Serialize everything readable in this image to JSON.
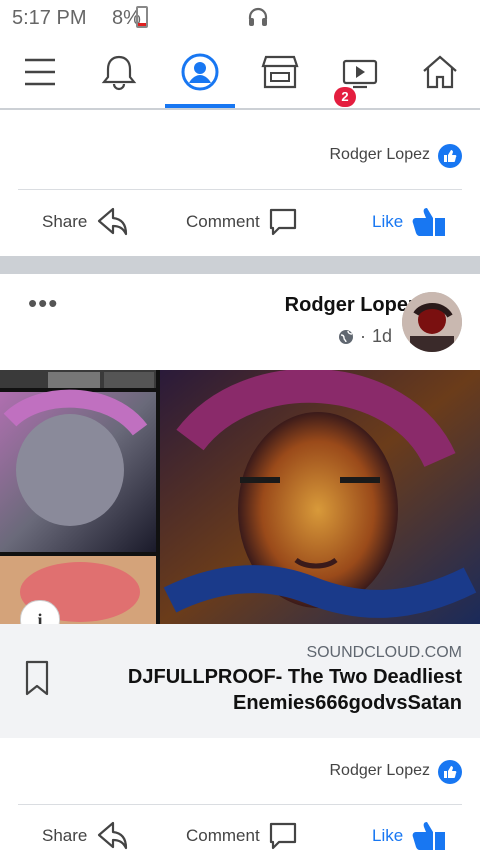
{
  "status": {
    "time": "5:17 PM",
    "battery": "8%"
  },
  "nav": {
    "badge": "2"
  },
  "post1": {
    "reactor": "Rodger Lopez",
    "like": "Like",
    "comment": "Comment",
    "share": "Share"
  },
  "post2": {
    "author": "Rodger Lopez",
    "time": "1d",
    "dot": "·",
    "more": "•••",
    "domain": "SOUNDCLOUD.COM",
    "title": "DJFULLPROOF- The Two Deadliest Enemies666godvsSatan",
    "reactor": "Rodger Lopez",
    "like": "Like",
    "comment": "Comment",
    "share": "Share",
    "info": "i"
  },
  "colors": {
    "accent": "#1877f2",
    "badge": "#e41e3f",
    "separator": "#ccd0d5"
  }
}
